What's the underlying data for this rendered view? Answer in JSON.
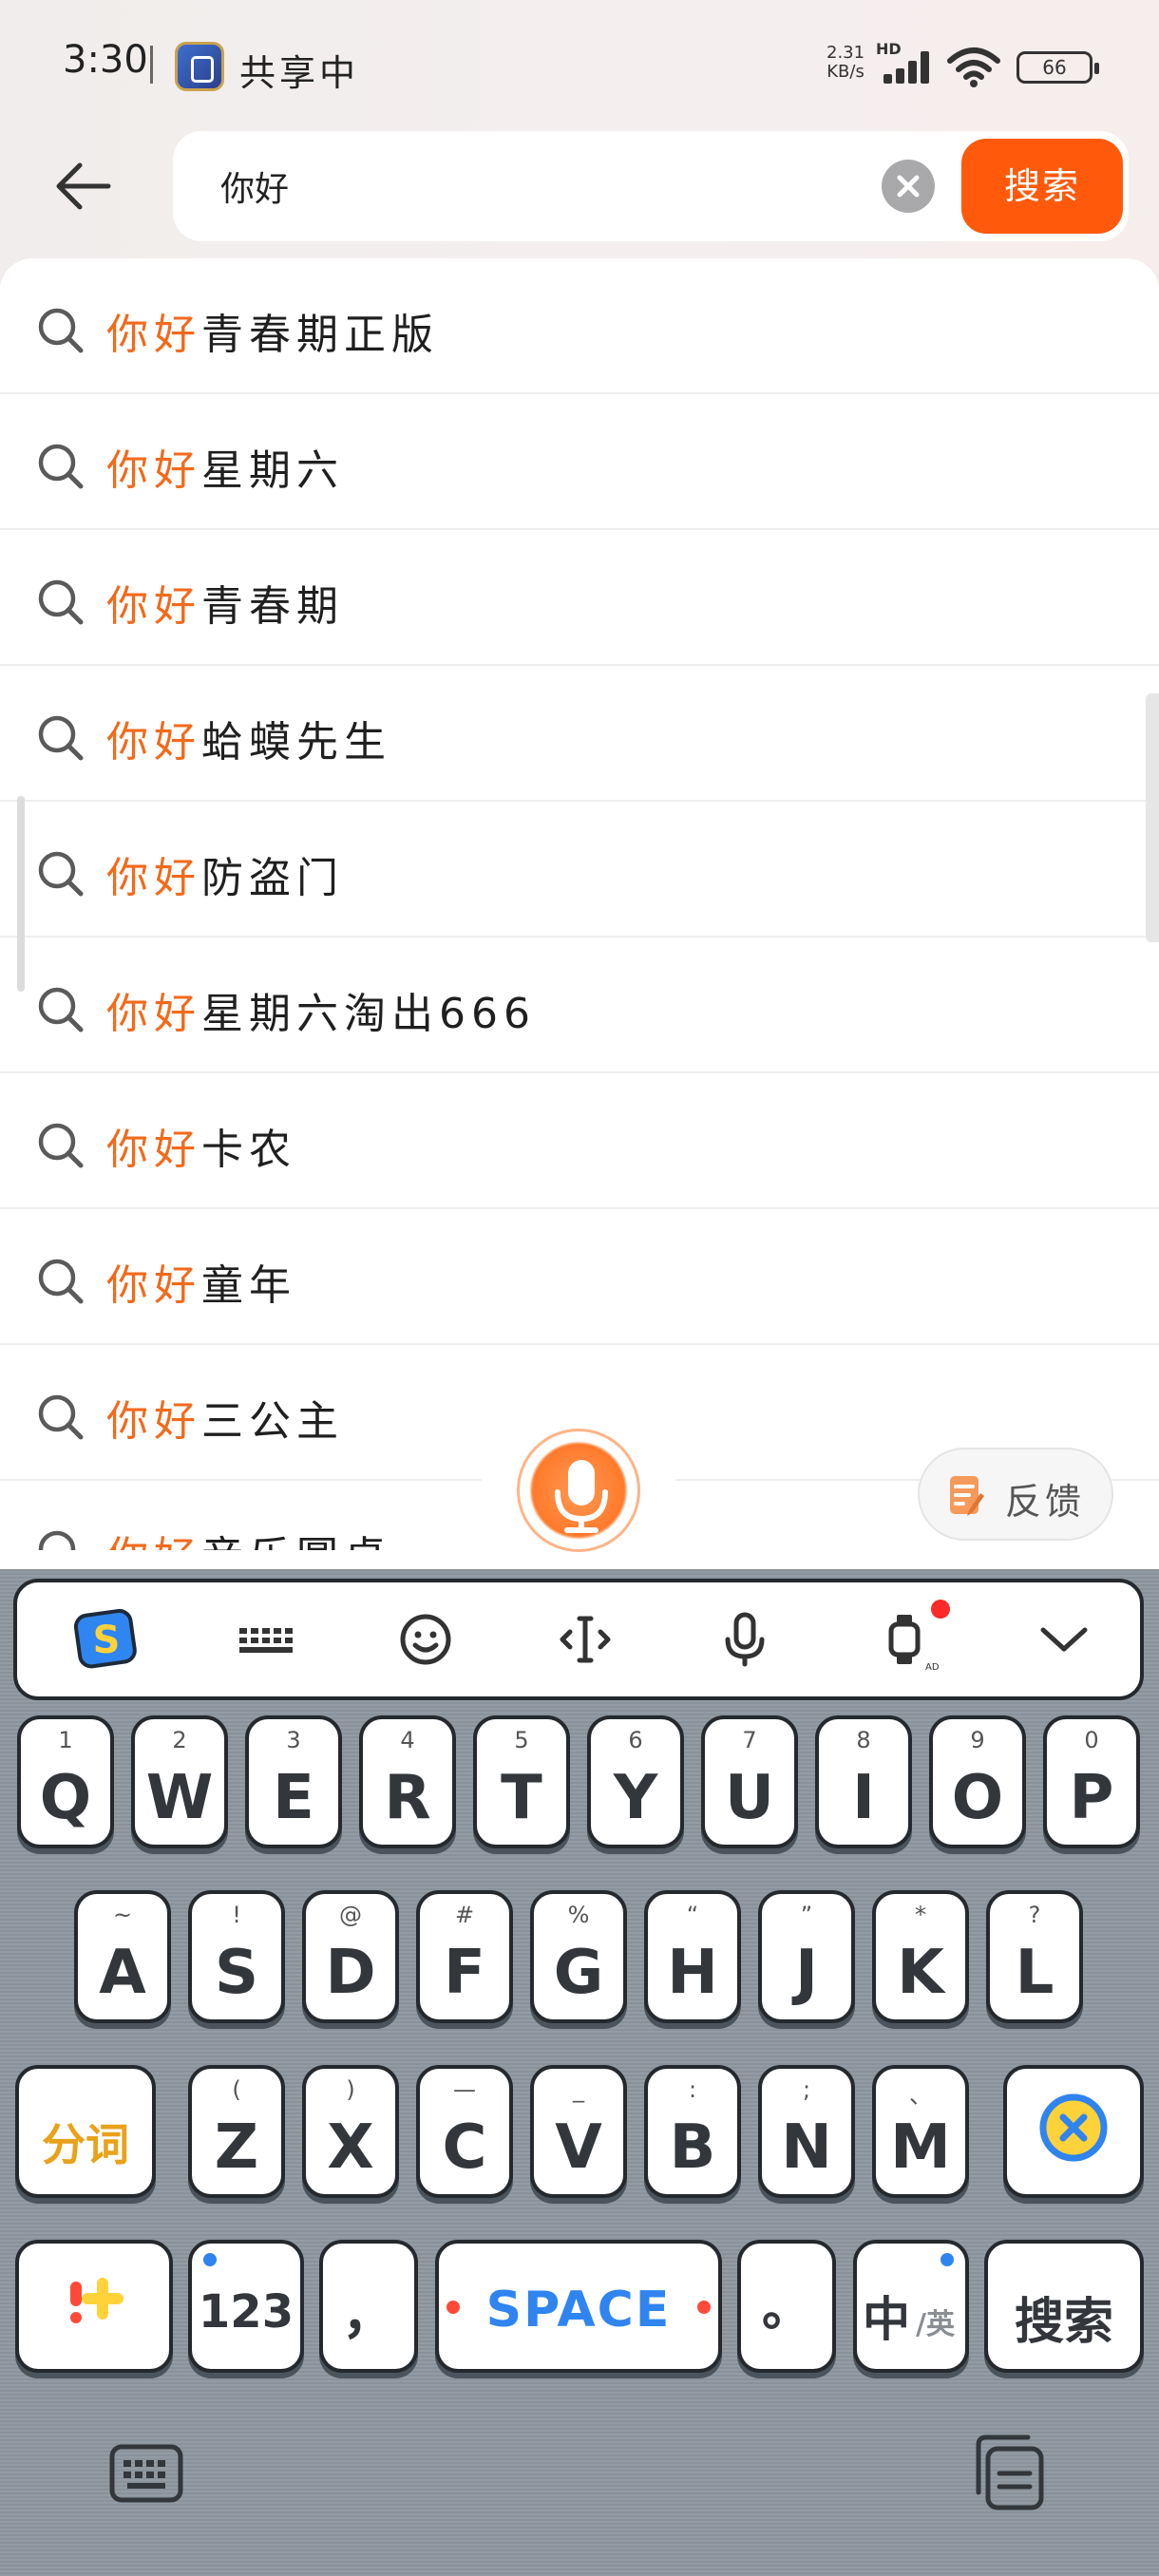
{
  "status_bar": {
    "time": "3:30",
    "sharing": "共享中",
    "net_speed_value": "2.31",
    "net_speed_unit": "KB/s",
    "hd": "HD",
    "battery": "66"
  },
  "search": {
    "query": "你好",
    "button_label": "搜索"
  },
  "suggestions": [
    {
      "highlight": "你好",
      "rest": "青春期正版"
    },
    {
      "highlight": "你好",
      "rest": "星期六"
    },
    {
      "highlight": "你好",
      "rest": "青春期"
    },
    {
      "highlight": "你好",
      "rest": "蛤蟆先生"
    },
    {
      "highlight": "你好",
      "rest": "防盗门"
    },
    {
      "highlight": "你好",
      "rest": "星期六淘出666"
    },
    {
      "highlight": "你好",
      "rest": "卡农"
    },
    {
      "highlight": "你好",
      "rest": "童年"
    },
    {
      "highlight": "你好",
      "rest": "三公主"
    },
    {
      "highlight": "你好",
      "rest": "音乐圆桌"
    }
  ],
  "feedback": {
    "label": "反馈"
  },
  "keyboard": {
    "row1": [
      {
        "hint": "1",
        "main": "Q"
      },
      {
        "hint": "2",
        "main": "W"
      },
      {
        "hint": "3",
        "main": "E"
      },
      {
        "hint": "4",
        "main": "R"
      },
      {
        "hint": "5",
        "main": "T"
      },
      {
        "hint": "6",
        "main": "Y"
      },
      {
        "hint": "7",
        "main": "U"
      },
      {
        "hint": "8",
        "main": "I"
      },
      {
        "hint": "9",
        "main": "O"
      },
      {
        "hint": "0",
        "main": "P"
      }
    ],
    "row2": [
      {
        "hint": "~",
        "main": "A"
      },
      {
        "hint": "!",
        "main": "S"
      },
      {
        "hint": "@",
        "main": "D"
      },
      {
        "hint": "#",
        "main": "F"
      },
      {
        "hint": "%",
        "main": "G"
      },
      {
        "hint": "“",
        "main": "H"
      },
      {
        "hint": "”",
        "main": "J"
      },
      {
        "hint": "*",
        "main": "K"
      },
      {
        "hint": "?",
        "main": "L"
      }
    ],
    "row3": [
      {
        "hint": "(",
        "main": "Z"
      },
      {
        "hint": ")",
        "main": "X"
      },
      {
        "hint": "—",
        "main": "C"
      },
      {
        "hint": "_",
        "main": "V"
      },
      {
        "hint": ":",
        "main": "B"
      },
      {
        "hint": ";",
        "main": "N"
      },
      {
        "hint": "、",
        "main": "M"
      }
    ],
    "segment_key": "分词",
    "num_key": "123",
    "comma_key": "，",
    "space_key": "SPACE",
    "period_key": "。",
    "lang_key_main": "中",
    "lang_key_sub": "/英",
    "search_key": "搜索"
  },
  "colors": {
    "accent": "#ff5a0c",
    "highlight_text": "#f26a1b",
    "keyboard_bg": "#8d979f"
  }
}
